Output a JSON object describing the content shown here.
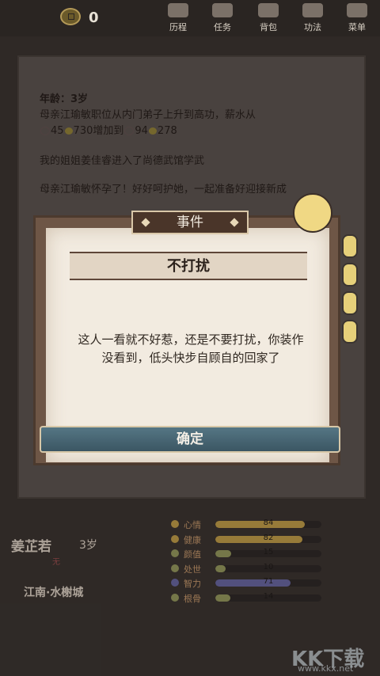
{
  "topbar": {
    "coins": "0",
    "nav": [
      {
        "label": "历程",
        "icon": "journey-icon"
      },
      {
        "label": "任务",
        "icon": "task-icon"
      },
      {
        "label": "背包",
        "icon": "bag-icon"
      },
      {
        "label": "功法",
        "icon": "skill-book-icon"
      },
      {
        "label": "菜单",
        "icon": "menu-icon"
      }
    ]
  },
  "log": {
    "age": "年龄：3岁",
    "line1": "母亲江瑜敏职位从内门弟子上升到高功，薪水从",
    "line2_a": "45",
    "line2_b": "730增加到",
    "line2_c": "94",
    "line2_d": "278",
    "line3": "我的姐姐姜佳睿进入了尚德武馆学武",
    "line4": "母亲江瑜敏怀孕了！好好呵护她，一起准备好迎接新成"
  },
  "modal": {
    "tag": "事件",
    "title": "不打扰",
    "body": "这人一看就不好惹，还是不要打扰，你装作没看到，低头快步自顾自的回家了",
    "confirm": "确定"
  },
  "character": {
    "name": "姜芷若",
    "age": "3岁",
    "sub": "无",
    "location": "江南·水榭城"
  },
  "stats": [
    {
      "name": "心情",
      "value": "84",
      "fill": 0.84,
      "color": "#c9a54a"
    },
    {
      "name": "健康",
      "value": "82",
      "fill": 0.82,
      "color": "#c9a54a"
    },
    {
      "name": "颜值",
      "value": "15",
      "fill": 0.15,
      "color": "#9aa060"
    },
    {
      "name": "处世",
      "value": "10",
      "fill": 0.1,
      "color": "#9aa060"
    },
    {
      "name": "智力",
      "value": "71",
      "fill": 0.71,
      "color": "#6a6aa8"
    },
    {
      "name": "根骨",
      "value": "14",
      "fill": 0.14,
      "color": "#9aa060"
    }
  ],
  "watermark": {
    "text": "KK下载",
    "url": "www.kkx.net"
  }
}
